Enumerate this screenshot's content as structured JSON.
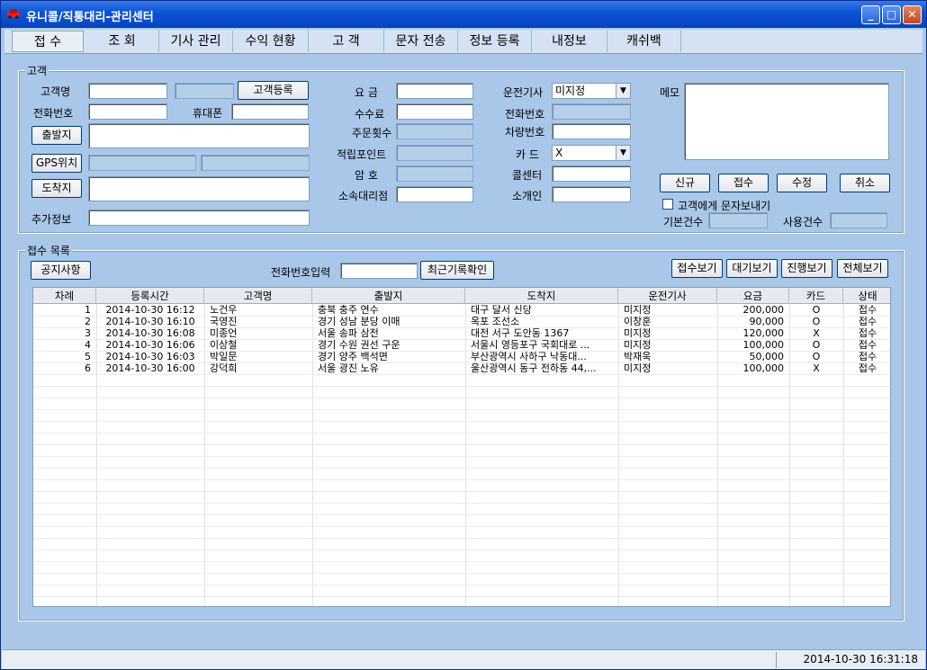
{
  "window": {
    "title": "유니콜/직통대리-관리센터",
    "minimize": "_",
    "maximize": "□",
    "close": "✕"
  },
  "menu": [
    {
      "label": "접 수"
    },
    {
      "label": "조 회"
    },
    {
      "label": "기사 관리"
    },
    {
      "label": "수익 현황"
    },
    {
      "label": "고 객"
    },
    {
      "label": "문자 전송"
    },
    {
      "label": "정보 등록"
    },
    {
      "label": "내정보"
    },
    {
      "label": "캐쉬백"
    }
  ],
  "customer": {
    "group_title": "고객",
    "name_label": "고객명",
    "register_button": "고객등록",
    "phone_label": "전화번호",
    "mobile_label": "휴대폰",
    "departure_button": "출발지",
    "gps_button": "GPS위치",
    "arrival_button": "도착지",
    "extra_label": "추가정보",
    "fee_label": "요 금",
    "commission_label": "수수료",
    "order_count_label": "주문횟수",
    "points_label": "적립포인트",
    "password_label": "암 호",
    "agency_label": "소속대리점",
    "driver_label": "운전기사",
    "driver_value": "미지정",
    "driver_phone_label": "전화번호",
    "car_no_label": "차량번호",
    "card_label": "카 드",
    "card_value": "X",
    "callcenter_label": "콜센터",
    "referrer_label": "소개인",
    "memo_label": "메모",
    "new_button": "신규",
    "accept_button": "접수",
    "edit_button": "수정",
    "cancel_button": "취소",
    "sms_checkbox_label": "고객에게 문자보내기",
    "base_count_label": "기본건수",
    "used_count_label": "사용건수"
  },
  "reception": {
    "group_title": "접수 목록",
    "notice_button": "공지사항",
    "phone_input_label": "전화번호입력",
    "recent_button": "최근기록확인",
    "view_accept": "접수보기",
    "view_wait": "대기보기",
    "view_progress": "진행보기",
    "view_all": "전체보기",
    "columns": [
      "차례",
      "등록시간",
      "고객명",
      "출발지",
      "도착지",
      "운전기사",
      "요금",
      "카드",
      "상태"
    ],
    "rows": [
      [
        "1",
        "2014-10-30 16:12",
        "노건우",
        "충북 충주 연수",
        "대구 달서 신당",
        "미지정",
        "200,000",
        "O",
        "접수"
      ],
      [
        "2",
        "2014-10-30 16:10",
        "국영진",
        "경기 성남 분당 이매",
        "옥포 조선소",
        "이창훈",
        "90,000",
        "O",
        "접수"
      ],
      [
        "3",
        "2014-10-30 16:08",
        "미종언",
        "서울 송파 삼전",
        "대전 서구 도안동 1367",
        "미지정",
        "120,000",
        "X",
        "접수"
      ],
      [
        "4",
        "2014-10-30 16:06",
        "이상철",
        "경기 수원 권선 구운",
        "서울시 영등포구 국회대로 ...",
        "미지정",
        "100,000",
        "O",
        "접수"
      ],
      [
        "5",
        "2014-10-30 16:03",
        "박일문",
        "경기 양주 백석면",
        "부산광역시 사하구 낙동대...",
        "박재욱",
        "50,000",
        "O",
        "접수"
      ],
      [
        "6",
        "2014-10-30 16:00",
        "강덕희",
        "서울 광진 노유",
        "울산광역시 동구 전하동 44,...",
        "미지정",
        "100,000",
        "X",
        "접수"
      ]
    ]
  },
  "status": {
    "clock": "2014-10-30 16:31:18"
  }
}
